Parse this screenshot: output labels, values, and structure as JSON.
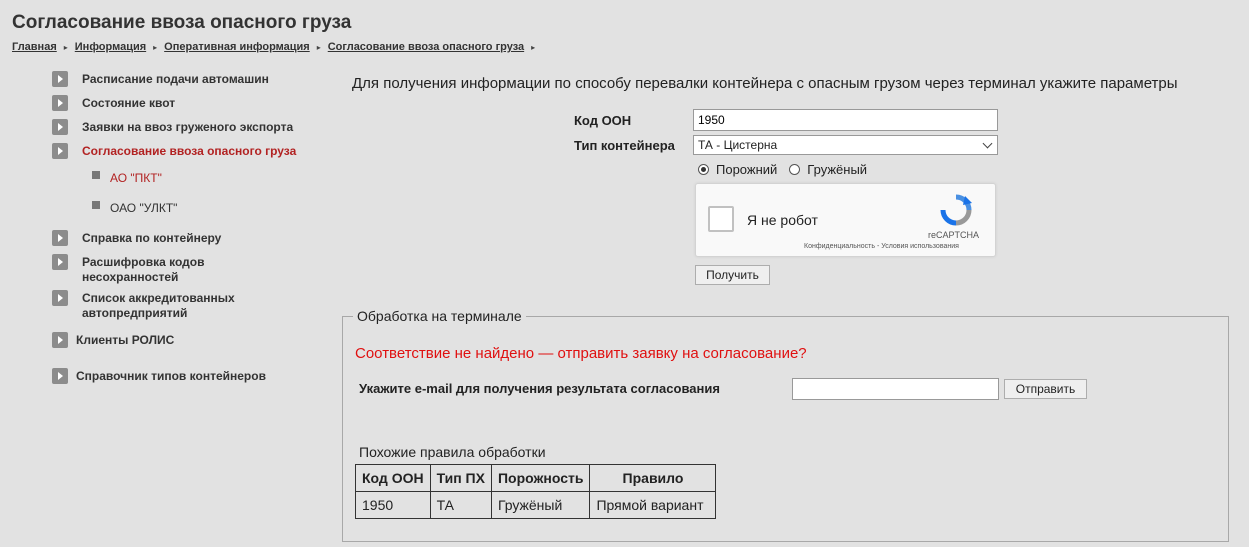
{
  "page_title": "Согласование ввоза опасного груза",
  "breadcrumb": [
    "Главная",
    "Информация",
    "Оперативная информация",
    "Согласование ввоза опасного груза"
  ],
  "breadcrumb_sep": "▸",
  "sidebar": {
    "items": [
      {
        "label": "Расписание подачи автомашин"
      },
      {
        "label": "Состояние квот"
      },
      {
        "label": "Заявки на ввоз груженого экспорта"
      },
      {
        "label": "Согласование ввоза опасного груза"
      },
      {
        "label": "Справка по контейнеру"
      },
      {
        "label": "Расшифровка кодов несохранностей"
      },
      {
        "label": "Список аккредитованных автопредприятий"
      },
      {
        "label": "Клиенты РОЛИС"
      },
      {
        "label": "Справочник типов контейнеров"
      }
    ],
    "subitems": [
      {
        "label": "АО \"ПКТ\""
      },
      {
        "label": "ОАО \"УЛКТ\""
      }
    ]
  },
  "form": {
    "intro": "Для получения информации по способу перевалки контейнера с опасным грузом через терминал укажите параметры",
    "un_code_label": "Код ООН",
    "un_code_value": "1950",
    "container_type_label": "Тип контейнера",
    "container_type_value": "ТА - Цистерна",
    "radio_empty": "Порожний",
    "radio_loaded": "Гружёный",
    "submit": "Получить"
  },
  "captcha": {
    "label": "Я не робот",
    "brand": "reCAPTCHA",
    "terms": "Конфиденциальность - Условия использования"
  },
  "terminal": {
    "legend": "Обработка на терминале",
    "not_found": "Соответствие не найдено — отправить заявку на согласование?",
    "email_label": "Укажите e-mail для получения результата согласования",
    "email_value": "",
    "send": "Отправить",
    "similar_title": "Похожие правила обработки",
    "table": {
      "headers": [
        "Код ООН",
        "Тип ПХ",
        "Порожность",
        "Правило"
      ],
      "rows": [
        [
          "1950",
          "ТА",
          "Гружёный",
          "Прямой вариант"
        ]
      ]
    }
  },
  "colors": {
    "background": "#e2e2e2",
    "active_link": "#b22222",
    "alert": "#e01010"
  }
}
